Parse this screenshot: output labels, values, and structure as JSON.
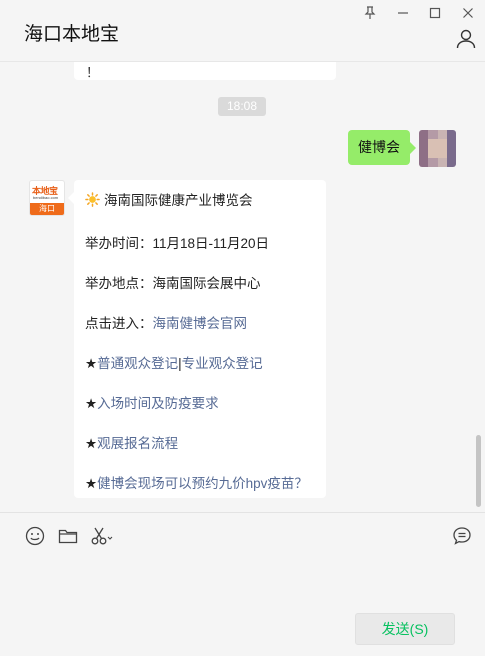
{
  "window": {
    "title": "海口本地宝",
    "controls": [
      "pin-icon",
      "minimize-icon",
      "maximize-icon",
      "close-icon"
    ]
  },
  "chat": {
    "previous_fragment": "！",
    "timestamp": "18:08",
    "sent_message": "健博会",
    "received": {
      "sender_logo": {
        "brand": "本地宝",
        "url_text": "bendibao.com",
        "city": "海口",
        "color": "#ef6b1a"
      },
      "title": "海南国际健康产业博览会",
      "time_label": "举办时间：",
      "time_value": "11月18日-11月20日",
      "place_label": "举办地点：",
      "place_value": "海南国际会展中心",
      "enter_label": "点击进入：",
      "enter_link": "海南健博会官网",
      "item1_star": "★",
      "item1_link_a": "普通观众登记",
      "item1_sep": "|",
      "item1_link_b": "专业观众登记",
      "item2_star": "★",
      "item2_link": "入场时间及防疫要求",
      "item3_star": "★",
      "item3_link": "观展报名流程",
      "item4_star": "★",
      "item4_link": "健博会现场可以预约九价hpv疫苗？"
    }
  },
  "input_toolbar": {
    "icons": [
      "emoji-icon",
      "folder-icon",
      "scissors-icon",
      "chat-history-icon"
    ],
    "send_label": "发送(S)"
  },
  "colors": {
    "background": "#f5f5f5",
    "sent_bubble": "#95ec69",
    "link": "#576b95",
    "send_text": "#07c160"
  }
}
